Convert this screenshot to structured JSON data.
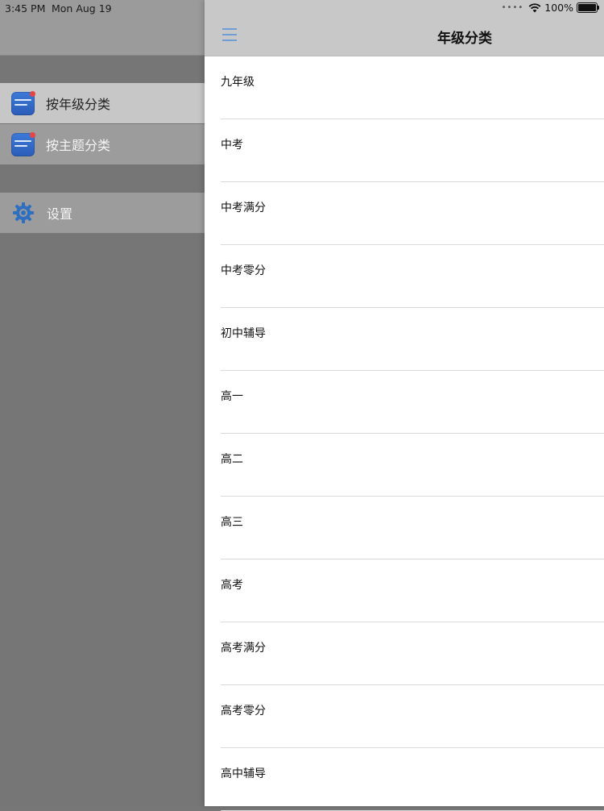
{
  "status": {
    "time": "3:45 PM",
    "date": "Mon Aug 19",
    "battery": "100%"
  },
  "drawer": {
    "items": [
      {
        "label": "按年级分类"
      },
      {
        "label": "按主题分类"
      }
    ],
    "settings": {
      "label": "设置"
    }
  },
  "nav": {
    "title": "年级分类"
  },
  "list": [
    "九年级",
    "中考",
    "中考满分",
    "中考零分",
    "初中辅导",
    "高一",
    "高二",
    "高三",
    "高考",
    "高考满分",
    "高考零分",
    "高中辅导"
  ]
}
